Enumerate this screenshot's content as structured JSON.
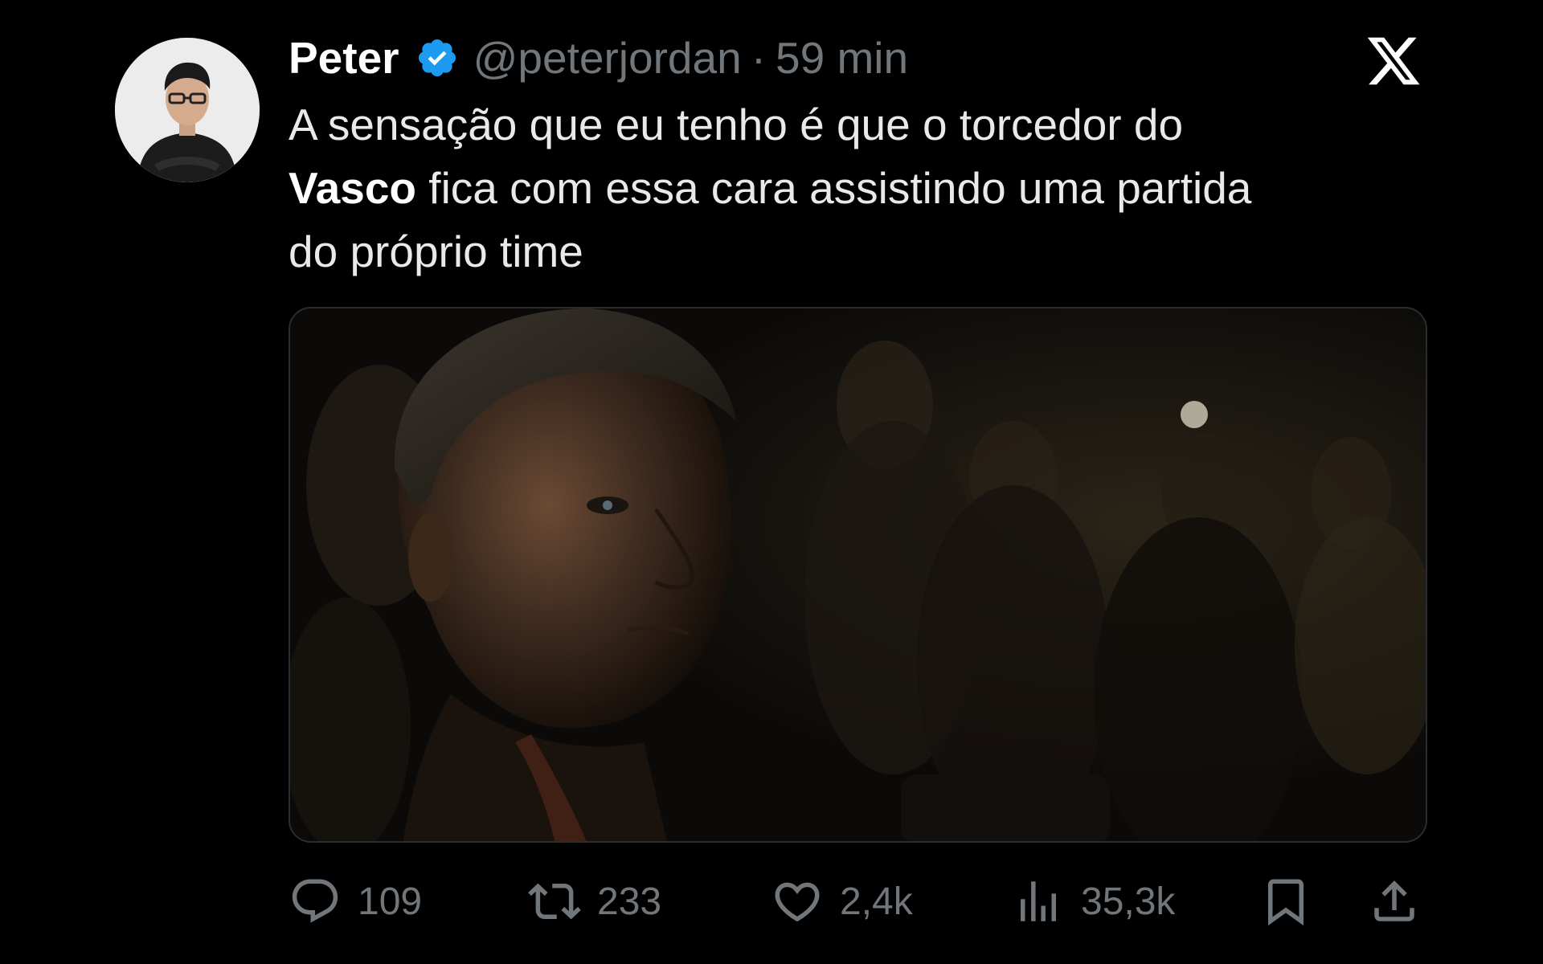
{
  "tweet": {
    "author": {
      "name": "Peter",
      "handle": "@peterjordan",
      "verified": true
    },
    "separator": "·",
    "time": "59 min",
    "text": {
      "line1": "A sensação que eu tenho é que o torcedor do",
      "line2_bold": "Vasco",
      "line2_rest": " fica com essa cara assistindo uma partida",
      "line3": "do próprio time"
    },
    "stats": {
      "replies": "109",
      "retweets": "233",
      "likes": "2,4k",
      "views": "35,3k"
    }
  },
  "icons": {
    "logo": "x-logo-icon",
    "verified": "verified-badge-icon",
    "reply": "reply-icon",
    "retweet": "retweet-icon",
    "like": "heart-icon",
    "views": "views-chart-icon",
    "bookmark": "bookmark-icon",
    "share": "share-icon"
  },
  "colors": {
    "background": "#000000",
    "text": "#e7e9ea",
    "secondary": "#71767b",
    "verified": "#1d9bf0"
  }
}
